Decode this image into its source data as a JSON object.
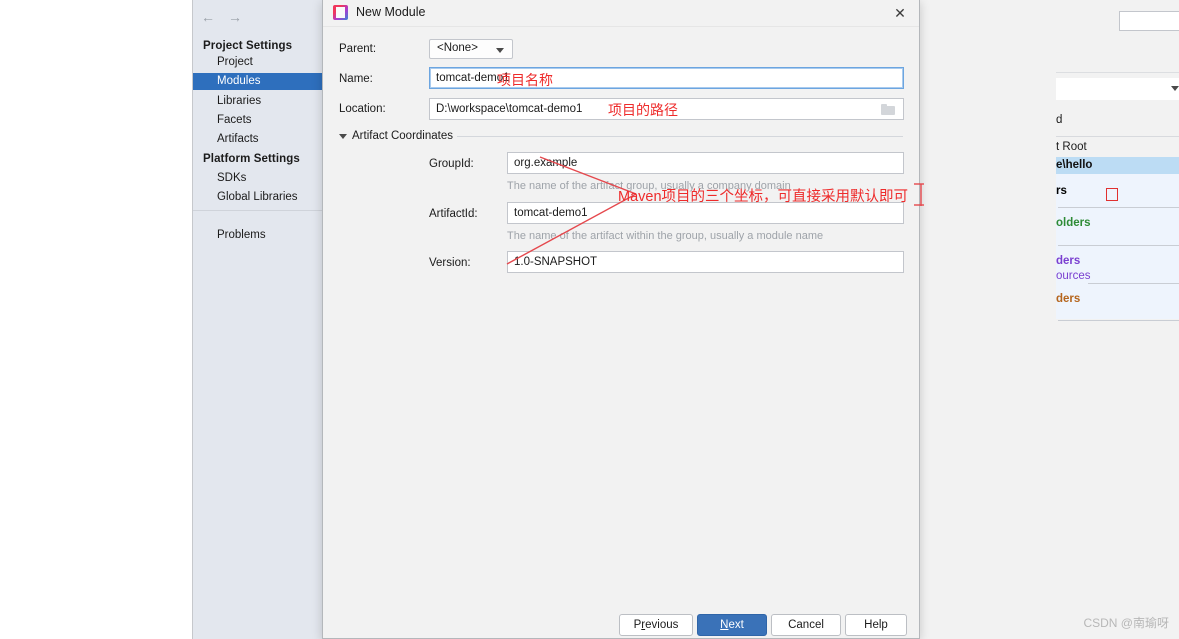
{
  "settings_window": {
    "nav": {
      "back_icon": "arrow-left-icon",
      "forward_icon": "arrow-right-icon"
    },
    "sidebar": {
      "groups": [
        {
          "label": "Project Settings"
        },
        {
          "label": "Platform Settings"
        }
      ],
      "items": [
        {
          "label": "Project",
          "selected": false
        },
        {
          "label": "Modules",
          "selected": true
        },
        {
          "label": "Libraries",
          "selected": false
        },
        {
          "label": "Facets",
          "selected": false
        },
        {
          "label": "Artifacts",
          "selected": false
        },
        {
          "label": "SDKs",
          "selected": false
        },
        {
          "label": "Global Libraries",
          "selected": false
        },
        {
          "label": "Problems",
          "selected": false
        }
      ]
    },
    "background_panel": {
      "cut_label_d": "d",
      "content_root_label": "t Root",
      "selected_path": "e\\hello",
      "entries": [
        {
          "label": "rs",
          "color": "#1560c0"
        },
        {
          "label": "olders",
          "color": "#2e8b36"
        },
        {
          "label": "ders",
          "color": "#7a3fd0"
        },
        {
          "label": "ources",
          "color": "#7a3fd0"
        },
        {
          "label": "ders",
          "color": "#b5651d"
        }
      ],
      "remove_icon": "close-icon",
      "edit_icon": "pencil-icon"
    }
  },
  "dialog": {
    "title": "New Module",
    "app_icon": "intellij-idea-icon",
    "close_icon": "close-icon",
    "fields": {
      "parent_label": "Parent:",
      "parent_value": "<None>",
      "name_label": "Name:",
      "name_value": "tomcat-demo1",
      "location_label": "Location:",
      "location_value": "D:\\workspace\\tomcat-demo1",
      "browse_icon": "folder-icon"
    },
    "artifact_section": {
      "title": "Artifact Coordinates",
      "expand_icon": "chevron-down-icon",
      "group_id_label": "GroupId:",
      "group_id_value": "org.example",
      "group_id_hint": "The name of the artifact group, usually a company domain",
      "artifact_id_label": "ArtifactId:",
      "artifact_id_value": "tomcat-demo1",
      "artifact_id_hint": "The name of the artifact within the group, usually a module name",
      "version_label": "Version:",
      "version_value": "1.0-SNAPSHOT"
    },
    "buttons": {
      "previous": {
        "prefix": "P",
        "mnemonic": "r",
        "rest": "evious"
      },
      "next": {
        "prefix": "",
        "mnemonic": "N",
        "rest": "ext"
      },
      "cancel": "Cancel",
      "help": "Help"
    }
  },
  "annotations": {
    "name_note": "项目名称",
    "path_note": "项目的路径",
    "maven_note": "Maven项目的三个坐标，可直接采用默认即可",
    "color": "#ee2b2b"
  },
  "watermark": "CSDN @南瑜呀"
}
